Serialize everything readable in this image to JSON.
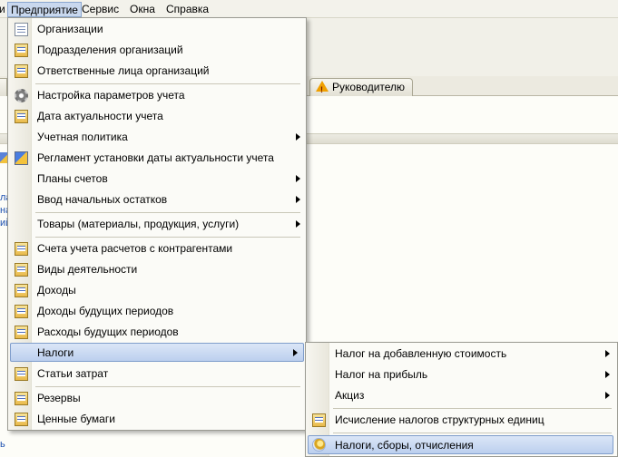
{
  "menubar": {
    "items": [
      {
        "label": "Предприятие",
        "active": true
      },
      {
        "label": "Сервис"
      },
      {
        "label": "Окна"
      },
      {
        "label": "Справка"
      }
    ],
    "left_fragment": "и"
  },
  "background": {
    "tab_label": "Руководителю",
    "left_links": [
      "ла",
      "начик",
      "ий"
    ],
    "bottom_fragment": "ь"
  },
  "menu": {
    "items": [
      {
        "label": "Организации",
        "icon": "document-icon"
      },
      {
        "label": "Подразделения организаций",
        "icon": "catalog-icon"
      },
      {
        "label": "Ответственные лица организаций",
        "icon": "catalog-icon"
      },
      {
        "label": "Настройка параметров учета",
        "icon": "gear-icon"
      },
      {
        "label": "Дата актуальности учета",
        "icon": "catalog-icon"
      },
      {
        "label": "Учетная политика",
        "submenu": true
      },
      {
        "label": "Регламент установки даты актуальности учета",
        "icon": "regulation-icon"
      },
      {
        "label": "Планы счетов",
        "submenu": true
      },
      {
        "label": "Ввод начальных остатков",
        "submenu": true
      },
      {
        "label": "Товары (материалы, продукция, услуги)",
        "submenu": true
      },
      {
        "label": "Счета учета расчетов с контрагентами",
        "icon": "catalog-icon"
      },
      {
        "label": "Виды деятельности",
        "icon": "catalog-icon"
      },
      {
        "label": "Доходы",
        "icon": "catalog-icon"
      },
      {
        "label": "Доходы будущих периодов",
        "icon": "catalog-icon"
      },
      {
        "label": "Расходы будущих периодов",
        "icon": "catalog-icon"
      },
      {
        "label": "Налоги",
        "submenu": true,
        "highlighted": true
      },
      {
        "label": "Статьи затрат",
        "icon": "catalog-icon"
      },
      {
        "label": "Резервы",
        "icon": "catalog-icon"
      },
      {
        "label": "Ценные бумаги",
        "icon": "catalog-icon"
      }
    ]
  },
  "submenu": {
    "items": [
      {
        "label": "Налог на добавленную стоимость",
        "submenu": true
      },
      {
        "label": "Налог на прибыль",
        "submenu": true
      },
      {
        "label": "Акциз",
        "submenu": true
      },
      {
        "label": "Исчисление налогов структурных единиц",
        "icon": "catalog-icon"
      },
      {
        "label": "Налоги, сборы, отчисления",
        "icon": "coins-icon",
        "highlighted": true
      }
    ]
  },
  "colors": {
    "highlight": "#bccfee",
    "highlight_border": "#7f9dcb",
    "menu_bg": "#fbfbf7",
    "link": "#1b4fb0"
  }
}
